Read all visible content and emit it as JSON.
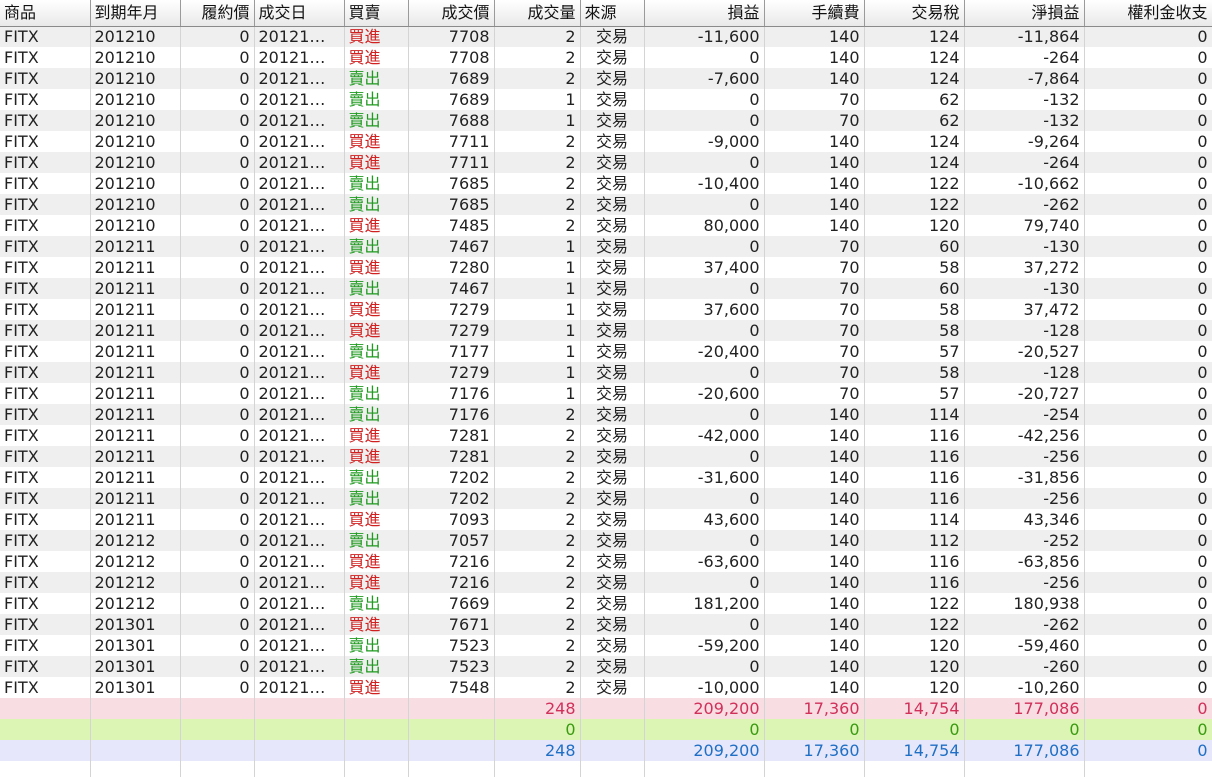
{
  "columns": [
    "商品",
    "到期年月",
    "履約價",
    "成交日",
    "買賣",
    "成交價",
    "成交量",
    "來源",
    "損益",
    "手續費",
    "交易稅",
    "淨損益",
    "權利金收支"
  ],
  "rows": [
    [
      "FITX",
      "201210",
      "0",
      "20121…",
      "買進",
      "7708",
      "2",
      "交易",
      "-11,600",
      "140",
      "124",
      "-11,864",
      "0"
    ],
    [
      "FITX",
      "201210",
      "0",
      "20121…",
      "買進",
      "7708",
      "2",
      "交易",
      "0",
      "140",
      "124",
      "-264",
      "0"
    ],
    [
      "FITX",
      "201210",
      "0",
      "20121…",
      "賣出",
      "7689",
      "2",
      "交易",
      "-7,600",
      "140",
      "124",
      "-7,864",
      "0"
    ],
    [
      "FITX",
      "201210",
      "0",
      "20121…",
      "賣出",
      "7689",
      "1",
      "交易",
      "0",
      "70",
      "62",
      "-132",
      "0"
    ],
    [
      "FITX",
      "201210",
      "0",
      "20121…",
      "賣出",
      "7688",
      "1",
      "交易",
      "0",
      "70",
      "62",
      "-132",
      "0"
    ],
    [
      "FITX",
      "201210",
      "0",
      "20121…",
      "買進",
      "7711",
      "2",
      "交易",
      "-9,000",
      "140",
      "124",
      "-9,264",
      "0"
    ],
    [
      "FITX",
      "201210",
      "0",
      "20121…",
      "買進",
      "7711",
      "2",
      "交易",
      "0",
      "140",
      "124",
      "-264",
      "0"
    ],
    [
      "FITX",
      "201210",
      "0",
      "20121…",
      "賣出",
      "7685",
      "2",
      "交易",
      "-10,400",
      "140",
      "122",
      "-10,662",
      "0"
    ],
    [
      "FITX",
      "201210",
      "0",
      "20121…",
      "賣出",
      "7685",
      "2",
      "交易",
      "0",
      "140",
      "122",
      "-262",
      "0"
    ],
    [
      "FITX",
      "201210",
      "0",
      "20121…",
      "買進",
      "7485",
      "2",
      "交易",
      "80,000",
      "140",
      "120",
      "79,740",
      "0"
    ],
    [
      "FITX",
      "201211",
      "0",
      "20121…",
      "賣出",
      "7467",
      "1",
      "交易",
      "0",
      "70",
      "60",
      "-130",
      "0"
    ],
    [
      "FITX",
      "201211",
      "0",
      "20121…",
      "買進",
      "7280",
      "1",
      "交易",
      "37,400",
      "70",
      "58",
      "37,272",
      "0"
    ],
    [
      "FITX",
      "201211",
      "0",
      "20121…",
      "賣出",
      "7467",
      "1",
      "交易",
      "0",
      "70",
      "60",
      "-130",
      "0"
    ],
    [
      "FITX",
      "201211",
      "0",
      "20121…",
      "買進",
      "7279",
      "1",
      "交易",
      "37,600",
      "70",
      "58",
      "37,472",
      "0"
    ],
    [
      "FITX",
      "201211",
      "0",
      "20121…",
      "買進",
      "7279",
      "1",
      "交易",
      "0",
      "70",
      "58",
      "-128",
      "0"
    ],
    [
      "FITX",
      "201211",
      "0",
      "20121…",
      "賣出",
      "7177",
      "1",
      "交易",
      "-20,400",
      "70",
      "57",
      "-20,527",
      "0"
    ],
    [
      "FITX",
      "201211",
      "0",
      "20121…",
      "買進",
      "7279",
      "1",
      "交易",
      "0",
      "70",
      "58",
      "-128",
      "0"
    ],
    [
      "FITX",
      "201211",
      "0",
      "20121…",
      "賣出",
      "7176",
      "1",
      "交易",
      "-20,600",
      "70",
      "57",
      "-20,727",
      "0"
    ],
    [
      "FITX",
      "201211",
      "0",
      "20121…",
      "賣出",
      "7176",
      "2",
      "交易",
      "0",
      "140",
      "114",
      "-254",
      "0"
    ],
    [
      "FITX",
      "201211",
      "0",
      "20121…",
      "買進",
      "7281",
      "2",
      "交易",
      "-42,000",
      "140",
      "116",
      "-42,256",
      "0"
    ],
    [
      "FITX",
      "201211",
      "0",
      "20121…",
      "買進",
      "7281",
      "2",
      "交易",
      "0",
      "140",
      "116",
      "-256",
      "0"
    ],
    [
      "FITX",
      "201211",
      "0",
      "20121…",
      "賣出",
      "7202",
      "2",
      "交易",
      "-31,600",
      "140",
      "116",
      "-31,856",
      "0"
    ],
    [
      "FITX",
      "201211",
      "0",
      "20121…",
      "賣出",
      "7202",
      "2",
      "交易",
      "0",
      "140",
      "116",
      "-256",
      "0"
    ],
    [
      "FITX",
      "201211",
      "0",
      "20121…",
      "買進",
      "7093",
      "2",
      "交易",
      "43,600",
      "140",
      "114",
      "43,346",
      "0"
    ],
    [
      "FITX",
      "201212",
      "0",
      "20121…",
      "賣出",
      "7057",
      "2",
      "交易",
      "0",
      "140",
      "112",
      "-252",
      "0"
    ],
    [
      "FITX",
      "201212",
      "0",
      "20121…",
      "買進",
      "7216",
      "2",
      "交易",
      "-63,600",
      "140",
      "116",
      "-63,856",
      "0"
    ],
    [
      "FITX",
      "201212",
      "0",
      "20121…",
      "買進",
      "7216",
      "2",
      "交易",
      "0",
      "140",
      "116",
      "-256",
      "0"
    ],
    [
      "FITX",
      "201212",
      "0",
      "20121…",
      "賣出",
      "7669",
      "2",
      "交易",
      "181,200",
      "140",
      "122",
      "180,938",
      "0"
    ],
    [
      "FITX",
      "201301",
      "0",
      "20121…",
      "買進",
      "7671",
      "2",
      "交易",
      "0",
      "140",
      "122",
      "-262",
      "0"
    ],
    [
      "FITX",
      "201301",
      "0",
      "20121…",
      "賣出",
      "7523",
      "2",
      "交易",
      "-59,200",
      "140",
      "120",
      "-59,460",
      "0"
    ],
    [
      "FITX",
      "201301",
      "0",
      "20121…",
      "賣出",
      "7523",
      "2",
      "交易",
      "0",
      "140",
      "120",
      "-260",
      "0"
    ],
    [
      "FITX",
      "201301",
      "0",
      "20121…",
      "買進",
      "7548",
      "2",
      "交易",
      "-10,000",
      "140",
      "120",
      "-10,260",
      "0"
    ]
  ],
  "summary_rows": [
    {
      "volume": "248",
      "pnl": "209,200",
      "fee": "17,360",
      "tax": "14,754",
      "net": "177,086",
      "premium": "0"
    },
    {
      "volume": "0",
      "pnl": "0",
      "fee": "0",
      "tax": "0",
      "net": "0",
      "premium": "0"
    },
    {
      "volume": "248",
      "pnl": "209,200",
      "fee": "17,360",
      "tax": "14,754",
      "net": "177,086",
      "premium": "0"
    }
  ],
  "colors": {
    "buy": "#d02020",
    "sell": "#1f9a1f",
    "summary1_bg": "#f8dde2",
    "summary1_text": "#d0305a",
    "summary2_bg": "#dcf5b4",
    "summary2_text": "#3a9a10",
    "summary3_bg": "#e7e7fb",
    "summary3_text": "#1f6fc5"
  }
}
